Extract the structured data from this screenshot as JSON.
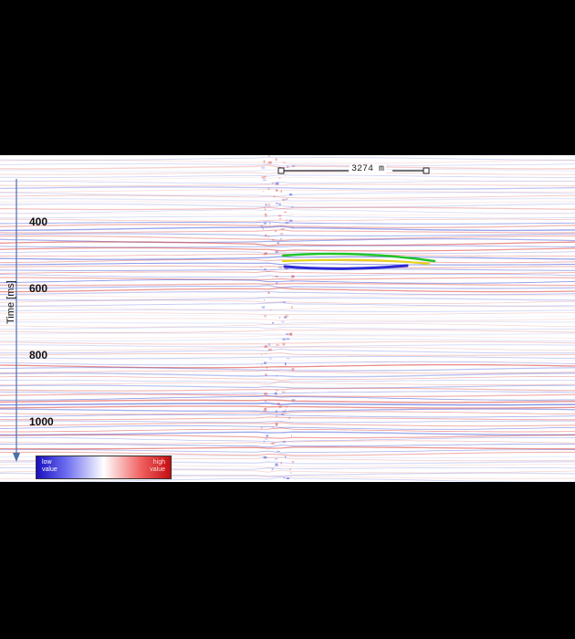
{
  "time_axis": {
    "title": "Time [ms]",
    "ticks": [
      "400",
      "600",
      "800",
      "1000"
    ]
  },
  "scale_bar": {
    "label": "3274  m"
  },
  "colorbar": {
    "low_label_1": "low",
    "low_label_2": "value",
    "high_label_1": "high",
    "high_label_2": "value",
    "low_color": "#1a0fbf",
    "mid_color": "#ffffff",
    "high_color": "#c40d10"
  },
  "horizons": [
    {
      "color": "#22c42a"
    },
    {
      "color": "#e6d21a"
    },
    {
      "color": "#2b2bd6"
    }
  ]
}
